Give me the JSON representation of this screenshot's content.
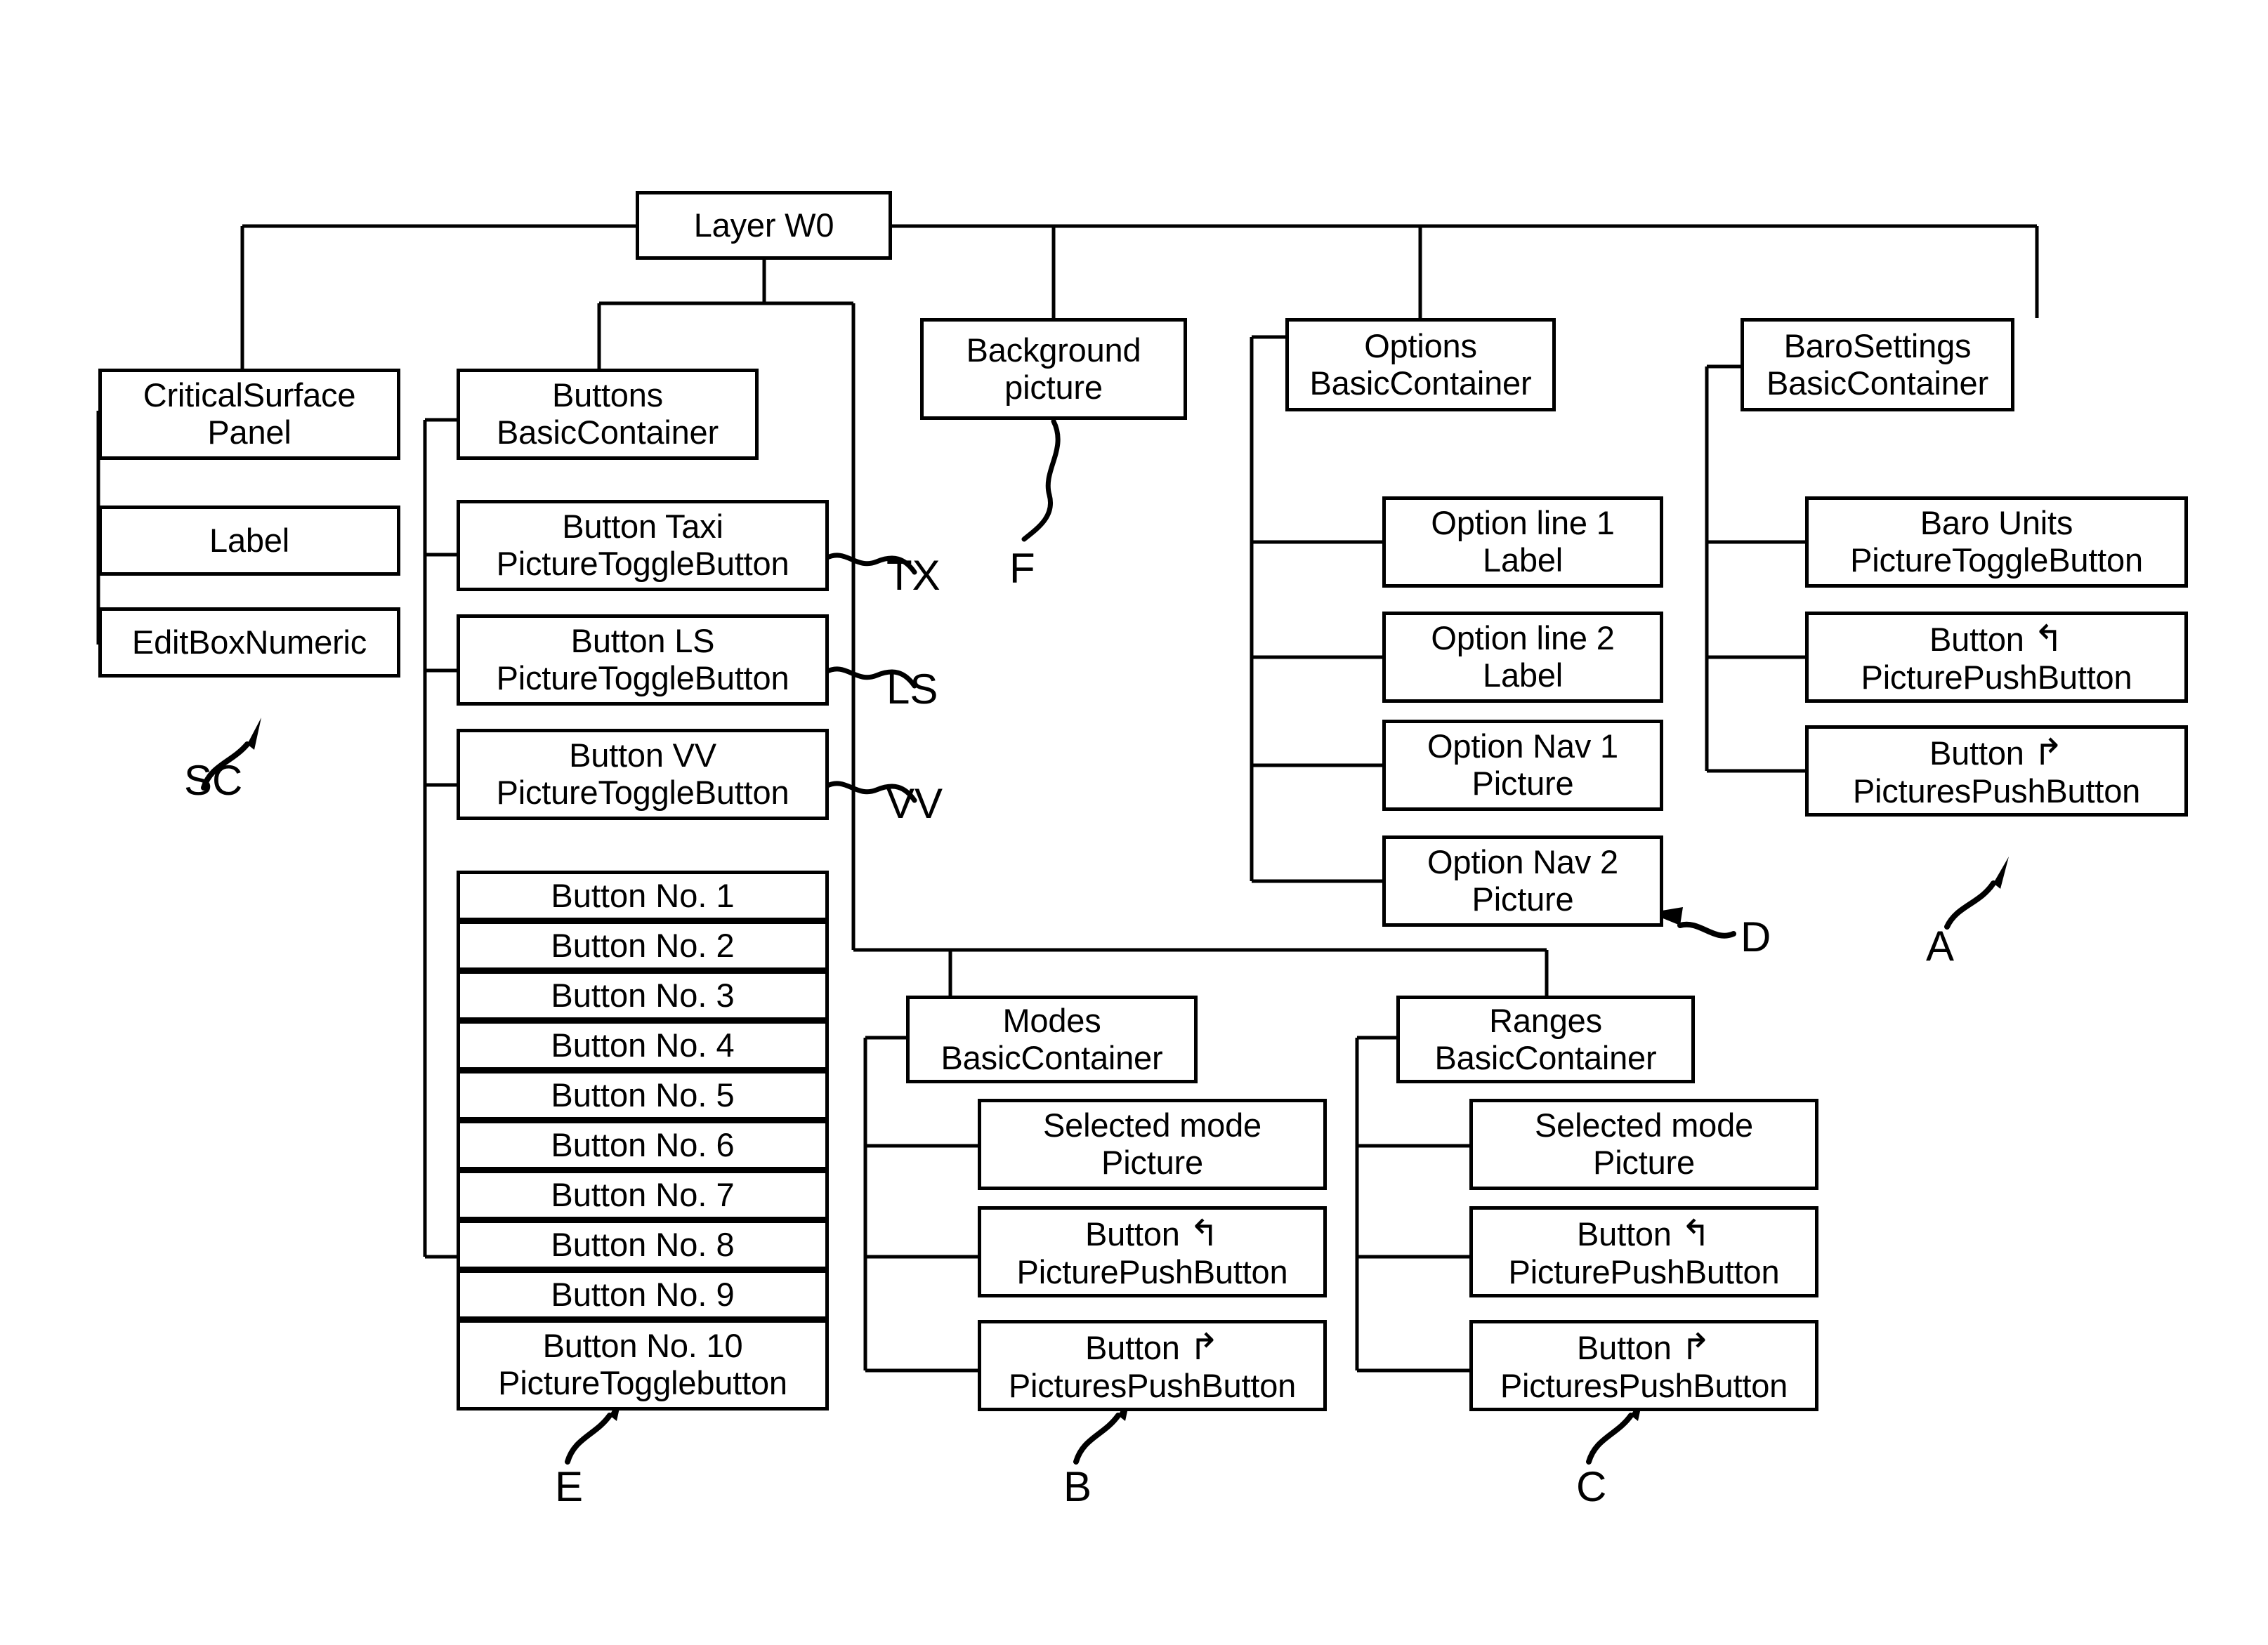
{
  "diagram": {
    "root": {
      "label": "Layer W0"
    },
    "background": {
      "line1": "Background",
      "line2": "picture"
    },
    "critical_surface": {
      "panel": {
        "line1": "CriticalSurface",
        "line2": "Panel"
      },
      "label": {
        "line1": "Label"
      },
      "editbox": {
        "line1": "EditBoxNumeric"
      }
    },
    "buttons_container": {
      "header": {
        "line1": "Buttons",
        "line2": "BasicContainer"
      },
      "toggle_buttons": [
        {
          "line1": "Button Taxi",
          "line2": "PictureToggleButton",
          "ref": "TX"
        },
        {
          "line1": "Button LS",
          "line2": "PictureToggleButton",
          "ref": "LS"
        },
        {
          "line1": "Button VV",
          "line2": "PictureToggleButton",
          "ref": "VV"
        }
      ],
      "numbered_buttons": [
        "Button No. 1",
        "Button No. 2",
        "Button No. 3",
        "Button No. 4",
        "Button No. 5",
        "Button No. 6",
        "Button No. 7",
        "Button No. 8",
        "Button No. 9"
      ],
      "last_button": {
        "line1": "Button No. 10",
        "line2": "PictureTogglebutton"
      }
    },
    "options_container": {
      "header": {
        "line1": "Options",
        "line2": "BasicContainer"
      },
      "items": [
        {
          "line1": "Option line 1",
          "line2": "Label"
        },
        {
          "line1": "Option line 2",
          "line2": "Label"
        },
        {
          "line1": "Option Nav 1",
          "line2": "Picture"
        },
        {
          "line1": "Option Nav 2",
          "line2": "Picture"
        }
      ]
    },
    "baro_settings_container": {
      "header": {
        "line1": "BaroSettings",
        "line2": "BasicContainer"
      },
      "items": [
        {
          "line1": "Baro Units",
          "line2": "PictureToggleButton",
          "icon": ""
        },
        {
          "line1": "Button",
          "line2": "PicturePushButton",
          "icon": "ccw-arrow-icon"
        },
        {
          "line1": "Button",
          "line2": "PicturesPushButton",
          "icon": "cw-arrow-icon"
        }
      ]
    },
    "modes_container": {
      "header": {
        "line1": "Modes",
        "line2": "BasicContainer"
      },
      "items": [
        {
          "line1": "Selected mode",
          "line2": "Picture",
          "icon": ""
        },
        {
          "line1": "Button",
          "line2": "PicturePushButton",
          "icon": "ccw-arrow-icon"
        },
        {
          "line1": "Button",
          "line2": "PicturesPushButton",
          "icon": "cw-arrow-icon"
        }
      ]
    },
    "ranges_container": {
      "header": {
        "line1": "Ranges",
        "line2": "BasicContainer"
      },
      "items": [
        {
          "line1": "Selected mode",
          "line2": "Picture",
          "icon": ""
        },
        {
          "line1": "Button",
          "line2": "PicturePushButton",
          "icon": "ccw-arrow-icon"
        },
        {
          "line1": "Button",
          "line2": "PicturesPushButton",
          "icon": "cw-arrow-icon"
        }
      ]
    },
    "reference_labels": {
      "sc": "SC",
      "e": "E",
      "b": "B",
      "c": "C",
      "d": "D",
      "a": "A",
      "f": "F"
    },
    "icons": {
      "ccw_arrow": "↰",
      "cw_arrow": "↱"
    },
    "colors": {
      "stroke": "#000000",
      "background": "#ffffff"
    }
  }
}
